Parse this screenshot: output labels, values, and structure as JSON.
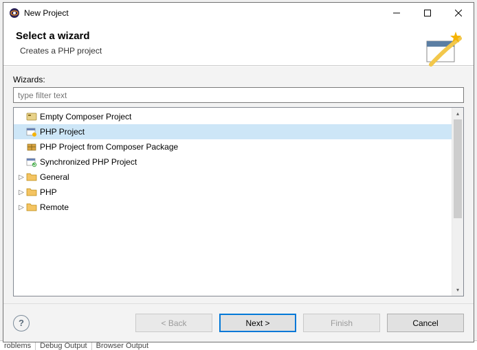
{
  "window": {
    "title": "New Project"
  },
  "header": {
    "title": "Select a wizard",
    "subtitle": "Creates a PHP project"
  },
  "wizards_label": "Wizards:",
  "filter_placeholder": "type filter text",
  "tree": [
    {
      "label": "Empty Composer Project",
      "icon": "composer",
      "expandable": false,
      "selected": false
    },
    {
      "label": "PHP Project",
      "icon": "php",
      "expandable": false,
      "selected": true
    },
    {
      "label": "PHP Project from Composer Package",
      "icon": "composer-pkg",
      "expandable": false,
      "selected": false
    },
    {
      "label": "Synchronized PHP Project",
      "icon": "sync-php",
      "expandable": false,
      "selected": false
    },
    {
      "label": "General",
      "icon": "folder",
      "expandable": true,
      "selected": false
    },
    {
      "label": "PHP",
      "icon": "folder",
      "expandable": true,
      "selected": false
    },
    {
      "label": "Remote",
      "icon": "folder",
      "expandable": true,
      "selected": false
    }
  ],
  "buttons": {
    "back": "< Back",
    "next": "Next >",
    "finish": "Finish",
    "cancel": "Cancel"
  },
  "behind_tabs": [
    "roblems",
    "Debug Output",
    "Browser Output"
  ]
}
